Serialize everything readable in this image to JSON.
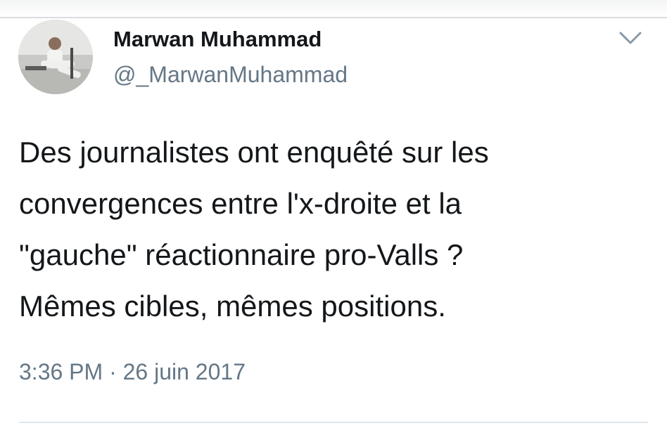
{
  "tweet": {
    "author_name": "Marwan Muhammad",
    "author_handle": "@_MarwanMuhammad",
    "text_lines": [
      "Des journalistes ont enquêté sur les",
      "convergences entre l'x-droite et la",
      "\"gauche\" réactionnaire pro-Valls ?",
      "Mêmes cibles, mêmes positions."
    ],
    "timestamp": "3:36 PM · 26 juin 2017"
  },
  "icons": {
    "menu": "chevron-down-icon"
  },
  "colors": {
    "text_primary": "#14171a",
    "text_secondary": "#657786",
    "divider": "#e1e8ed",
    "chevron": "#8899a6"
  }
}
